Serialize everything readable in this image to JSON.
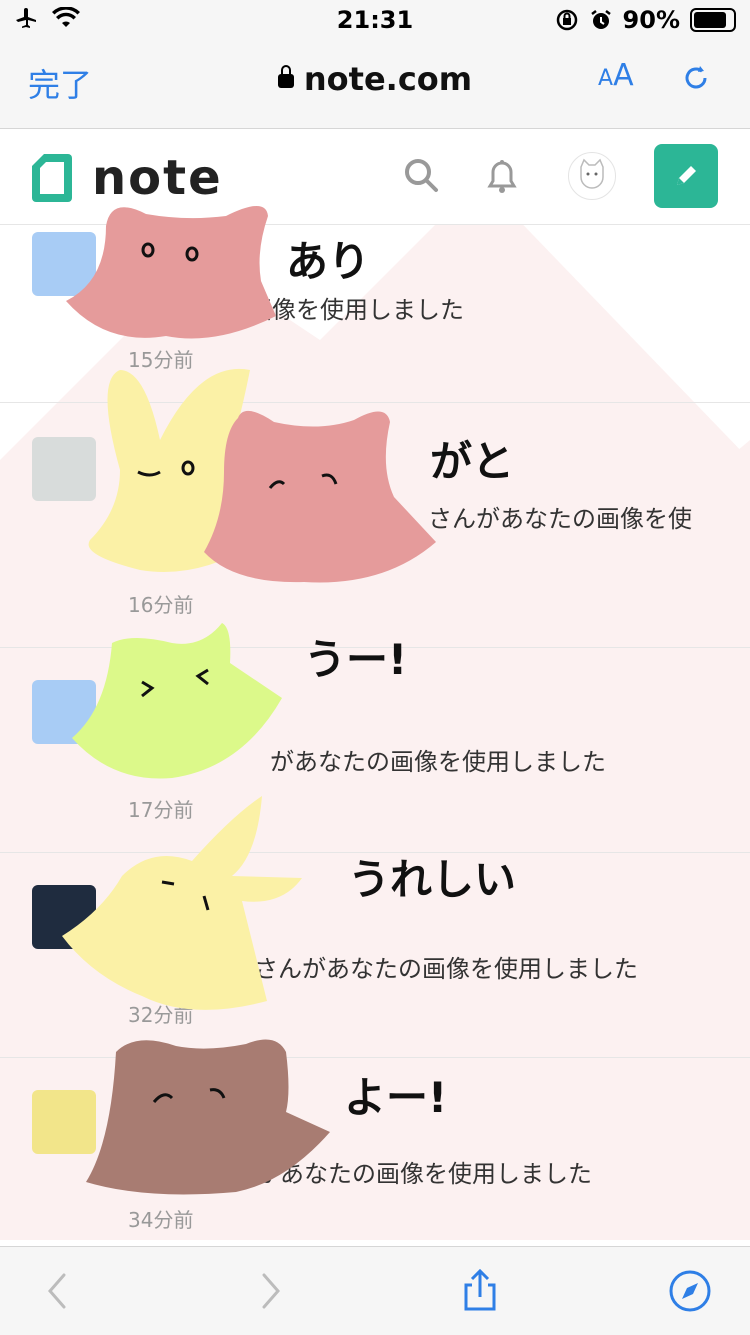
{
  "status": {
    "time": "21:31",
    "battery": "90%"
  },
  "browser": {
    "done_label": "完了",
    "url": "note.com",
    "aa_label_small": "A",
    "aa_label_big": "A"
  },
  "header": {
    "logo_text": "note"
  },
  "notifications": [
    {
      "text": "があなたの画像を使用しました",
      "time": "15分前"
    },
    {
      "text": "さんがあなたの画像を使",
      "time": "16分前"
    },
    {
      "text": "があなたの画像を使用しました",
      "time": "17分前"
    },
    {
      "text": "さんがあなたの画像を使用しました",
      "time": "32分前"
    },
    {
      "text": "れがあなたの画像を使用しました",
      "time": "34分前"
    }
  ],
  "handwriting": [
    "あり",
    "がと",
    "うー!",
    "うれしい",
    "よー!"
  ],
  "colors": {
    "accent": "#2f7fe6",
    "note_green": "#2cb696",
    "pink": "#e59b9b",
    "yellow": "#fbf1a6",
    "green": "#dcf98a",
    "brown": "#a87c72"
  }
}
